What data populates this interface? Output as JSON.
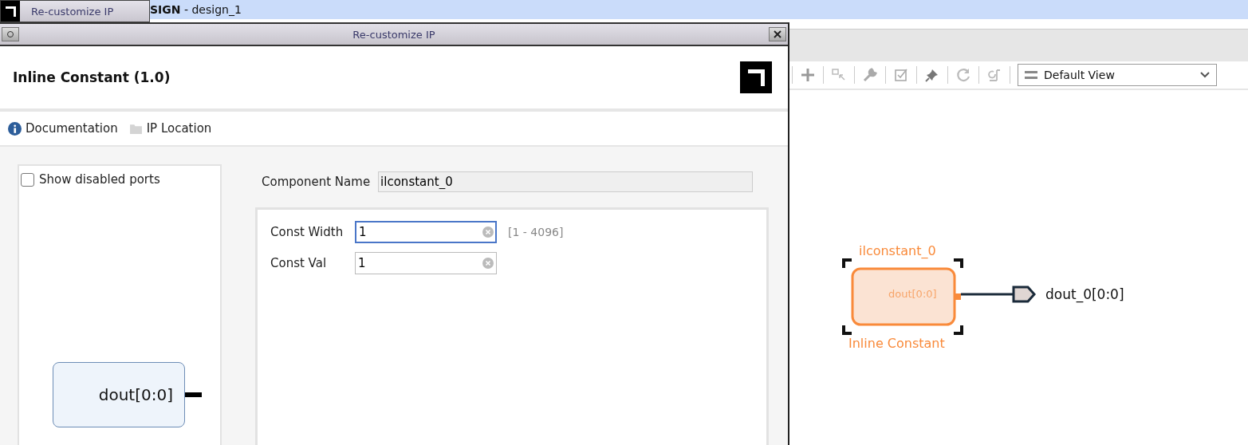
{
  "app_title": "**SIGN** - design_1",
  "taskbar_button": {
    "label": "Re-customize IP"
  },
  "toolbar": {
    "view_select": {
      "value": "Default View"
    }
  },
  "canvas": {
    "block": {
      "instance": "ilconstant_0",
      "type": "Inline Constant",
      "port": "dout[0:0]",
      "selected": true
    },
    "output_port": "dout_0[0:0]"
  },
  "dialog": {
    "title": "Re-customize IP",
    "heading": "Inline Constant (1.0)",
    "links": [
      {
        "label": "Documentation",
        "kind": "info"
      },
      {
        "label": "IP Location",
        "kind": "folder"
      }
    ],
    "show_disabled_ports": {
      "label": "Show disabled ports",
      "checked": false
    },
    "symbol": {
      "port": "dout[0:0]"
    },
    "component_name": {
      "label": "Component Name",
      "value": "ilconstant_0"
    },
    "params": [
      {
        "label": "Const Width",
        "value": "1",
        "focused": true,
        "range": "[1 - 4096]"
      },
      {
        "label": "Const Val",
        "value": "1",
        "focused": false
      }
    ]
  }
}
